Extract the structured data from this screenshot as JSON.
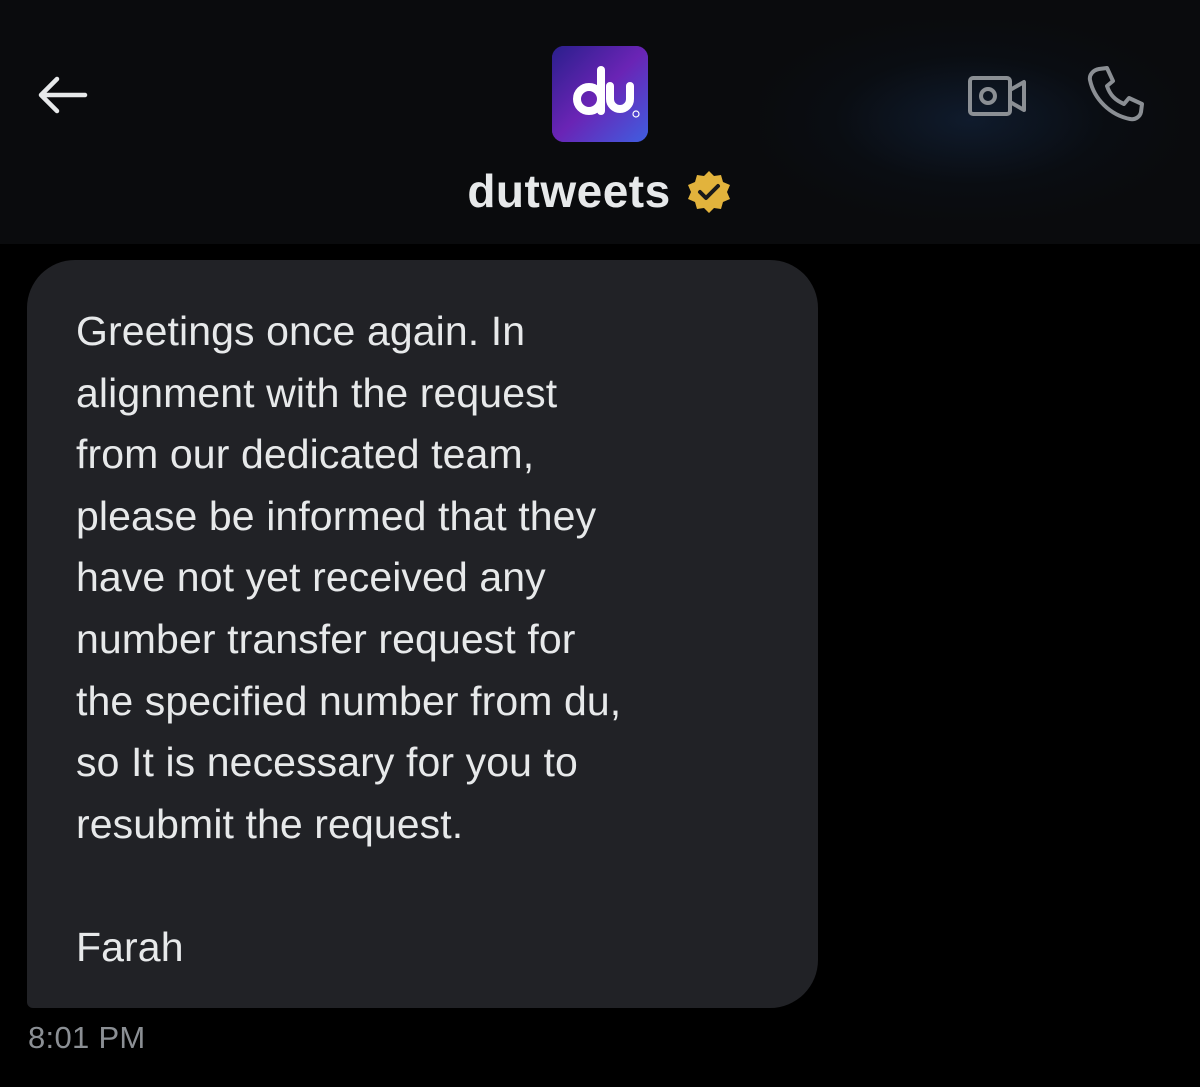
{
  "header": {
    "title": "dutweets",
    "verified": true,
    "avatar_logo_text": "du",
    "back_icon": "arrow-left-icon",
    "video_icon": "video-camera-icon",
    "call_icon": "phone-icon",
    "verified_icon": "verified-badge-icon"
  },
  "message": {
    "lines": [
      "Greetings once again. In",
      "alignment with the request",
      "from our dedicated team,",
      "please be informed that they",
      "have not yet received any",
      "number transfer request for",
      "the specified number from du,",
      "so It is necessary for you to",
      "resubmit the request.",
      "",
      "Farah"
    ],
    "timestamp": "8:01 PM"
  },
  "colors": {
    "background": "#000000",
    "header_background": "#0a0b0d",
    "bubble": "#212226",
    "text": "#e7e9ea",
    "muted": "#8b8f94",
    "verified_gold": "#e2b33c"
  }
}
